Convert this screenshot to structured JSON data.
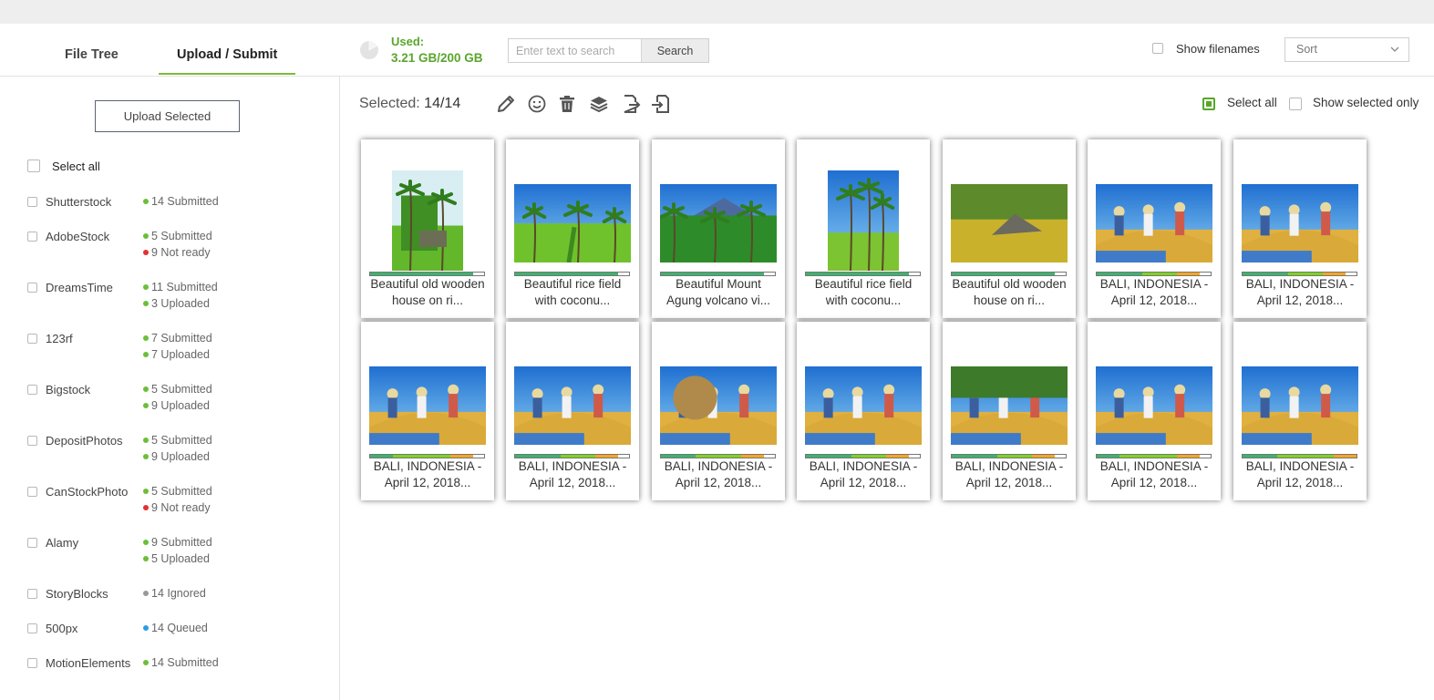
{
  "tabs": [
    {
      "label": "File Tree"
    },
    {
      "label": "Upload / Submit"
    }
  ],
  "storage": {
    "used_label": "Used:",
    "used_value": "3.21 GB/200 GB"
  },
  "search": {
    "placeholder": "Enter text to search",
    "button": "Search"
  },
  "show_filenames_label": "Show filenames",
  "sort": {
    "label": "Sort"
  },
  "sidebar": {
    "upload_button": "Upload Selected",
    "select_all": "Select all",
    "agencies": [
      {
        "name": "Shutterstock",
        "statuses": [
          {
            "text": "14 Submitted",
            "color": "#6abf3a"
          }
        ]
      },
      {
        "name": "AdobeStock",
        "statuses": [
          {
            "text": "5 Submitted",
            "color": "#6abf3a"
          },
          {
            "text": "9 Not ready",
            "color": "#e53030"
          }
        ]
      },
      {
        "name": "DreamsTime",
        "statuses": [
          {
            "text": "11 Submitted",
            "color": "#6abf3a"
          },
          {
            "text": "3 Uploaded",
            "color": "#6abf3a"
          }
        ]
      },
      {
        "name": "123rf",
        "statuses": [
          {
            "text": "7 Submitted",
            "color": "#6abf3a"
          },
          {
            "text": "7 Uploaded",
            "color": "#6abf3a"
          }
        ]
      },
      {
        "name": "Bigstock",
        "statuses": [
          {
            "text": "5 Submitted",
            "color": "#6abf3a"
          },
          {
            "text": "9 Uploaded",
            "color": "#6abf3a"
          }
        ]
      },
      {
        "name": "DepositPhotos",
        "statuses": [
          {
            "text": "5 Submitted",
            "color": "#6abf3a"
          },
          {
            "text": "9 Uploaded",
            "color": "#6abf3a"
          }
        ]
      },
      {
        "name": "CanStockPhoto",
        "statuses": [
          {
            "text": "5 Submitted",
            "color": "#6abf3a"
          },
          {
            "text": "9 Not ready",
            "color": "#e53030"
          }
        ]
      },
      {
        "name": "Alamy",
        "statuses": [
          {
            "text": "9 Submitted",
            "color": "#6abf3a"
          },
          {
            "text": "5 Uploaded",
            "color": "#6abf3a"
          }
        ]
      },
      {
        "name": "StoryBlocks",
        "statuses": [
          {
            "text": "14 Ignored",
            "color": "#999999"
          }
        ]
      },
      {
        "name": "500px",
        "statuses": [
          {
            "text": "14 Queued",
            "color": "#2a9fe0"
          }
        ]
      },
      {
        "name": "MotionElements",
        "statuses": [
          {
            "text": "14 Submitted",
            "color": "#6abf3a"
          }
        ]
      }
    ]
  },
  "toolbar": {
    "selected_label": "Selected:",
    "selected_value": "14/14",
    "tools": [
      "pencil-icon",
      "smiley-icon",
      "trash-icon",
      "layers-icon",
      "export-icon",
      "import-icon"
    ],
    "select_all_label": "Select all",
    "show_selected_only_label": "Show selected only"
  },
  "items": [
    {
      "cap1": "Beautiful old wooden",
      "cap2": "house on ri...",
      "scene": "palm-hut",
      "orientation": "portrait",
      "progress": [
        0.9
      ],
      "colors": [
        "#3cb36e"
      ]
    },
    {
      "cap1": "Beautiful rice field",
      "cap2": "with coconu...",
      "scene": "rice-palms",
      "orientation": "landscape",
      "progress": [
        0.9
      ],
      "colors": [
        "#3cb36e"
      ]
    },
    {
      "cap1": "Beautiful Mount",
      "cap2": "Agung volcano vi...",
      "scene": "jungle-volcano",
      "orientation": "landscape",
      "progress": [
        0.9
      ],
      "colors": [
        "#3cb36e"
      ]
    },
    {
      "cap1": "Beautiful rice field",
      "cap2": "with coconu...",
      "scene": "palm-tall",
      "orientation": "portrait",
      "progress": [
        0.9
      ],
      "colors": [
        "#3cb36e"
      ]
    },
    {
      "cap1": "Beautiful old wooden",
      "cap2": "house on ri...",
      "scene": "golden-hut",
      "orientation": "landscape",
      "progress": [
        0.9
      ],
      "colors": [
        "#3cb36e"
      ]
    },
    {
      "cap1": "BALI, INDONESIA -",
      "cap2": "April 12, 2018...",
      "scene": "harvest",
      "orientation": "landscape",
      "progress": [
        0.4,
        0.3,
        0.2
      ],
      "colors": [
        "#3cb36e",
        "#7ed321",
        "#f5a623"
      ]
    },
    {
      "cap1": "BALI, INDONESIA -",
      "cap2": "April 12, 2018...",
      "scene": "harvest",
      "orientation": "landscape",
      "progress": [
        0.4,
        0.3,
        0.2
      ],
      "colors": [
        "#3cb36e",
        "#7ed321",
        "#f5a623"
      ]
    },
    {
      "cap1": "BALI, INDONESIA -",
      "cap2": "April 12, 2018...",
      "scene": "harvest",
      "orientation": "landscape",
      "progress": [
        0.2,
        0.5,
        0.2
      ],
      "colors": [
        "#3cb36e",
        "#7ed321",
        "#f5a623"
      ]
    },
    {
      "cap1": "BALI, INDONESIA -",
      "cap2": "April 12, 2018...",
      "scene": "harvest",
      "orientation": "landscape",
      "progress": [
        0.4,
        0.3,
        0.2
      ],
      "colors": [
        "#3cb36e",
        "#7ed321",
        "#f5a623"
      ]
    },
    {
      "cap1": "BALI, INDONESIA -",
      "cap2": "April 12, 2018...",
      "scene": "harvest-basket",
      "orientation": "landscape",
      "progress": [
        0.3,
        0.4,
        0.2
      ],
      "colors": [
        "#3cb36e",
        "#7ed321",
        "#f5a623"
      ]
    },
    {
      "cap1": "BALI, INDONESIA -",
      "cap2": "April 12, 2018...",
      "scene": "harvest",
      "orientation": "landscape",
      "progress": [
        0.4,
        0.3,
        0.2
      ],
      "colors": [
        "#3cb36e",
        "#7ed321",
        "#f5a623"
      ]
    },
    {
      "cap1": "BALI, INDONESIA -",
      "cap2": "April 12, 2018...",
      "scene": "harvest-trees",
      "orientation": "landscape",
      "progress": [
        0.4,
        0.3,
        0.2
      ],
      "colors": [
        "#3cb36e",
        "#7ed321",
        "#f5a623"
      ]
    },
    {
      "cap1": "BALI, INDONESIA -",
      "cap2": "April 12, 2018...",
      "scene": "harvest",
      "orientation": "landscape",
      "progress": [
        0.2,
        0.5,
        0.2
      ],
      "colors": [
        "#3cb36e",
        "#7ed321",
        "#f5a623"
      ]
    },
    {
      "cap1": "BALI, INDONESIA -",
      "cap2": "April 12, 2018...",
      "scene": "harvest",
      "orientation": "landscape",
      "progress": [
        0.3,
        0.5,
        0.2
      ],
      "colors": [
        "#3cb36e",
        "#7ed321",
        "#f5a623"
      ]
    }
  ]
}
